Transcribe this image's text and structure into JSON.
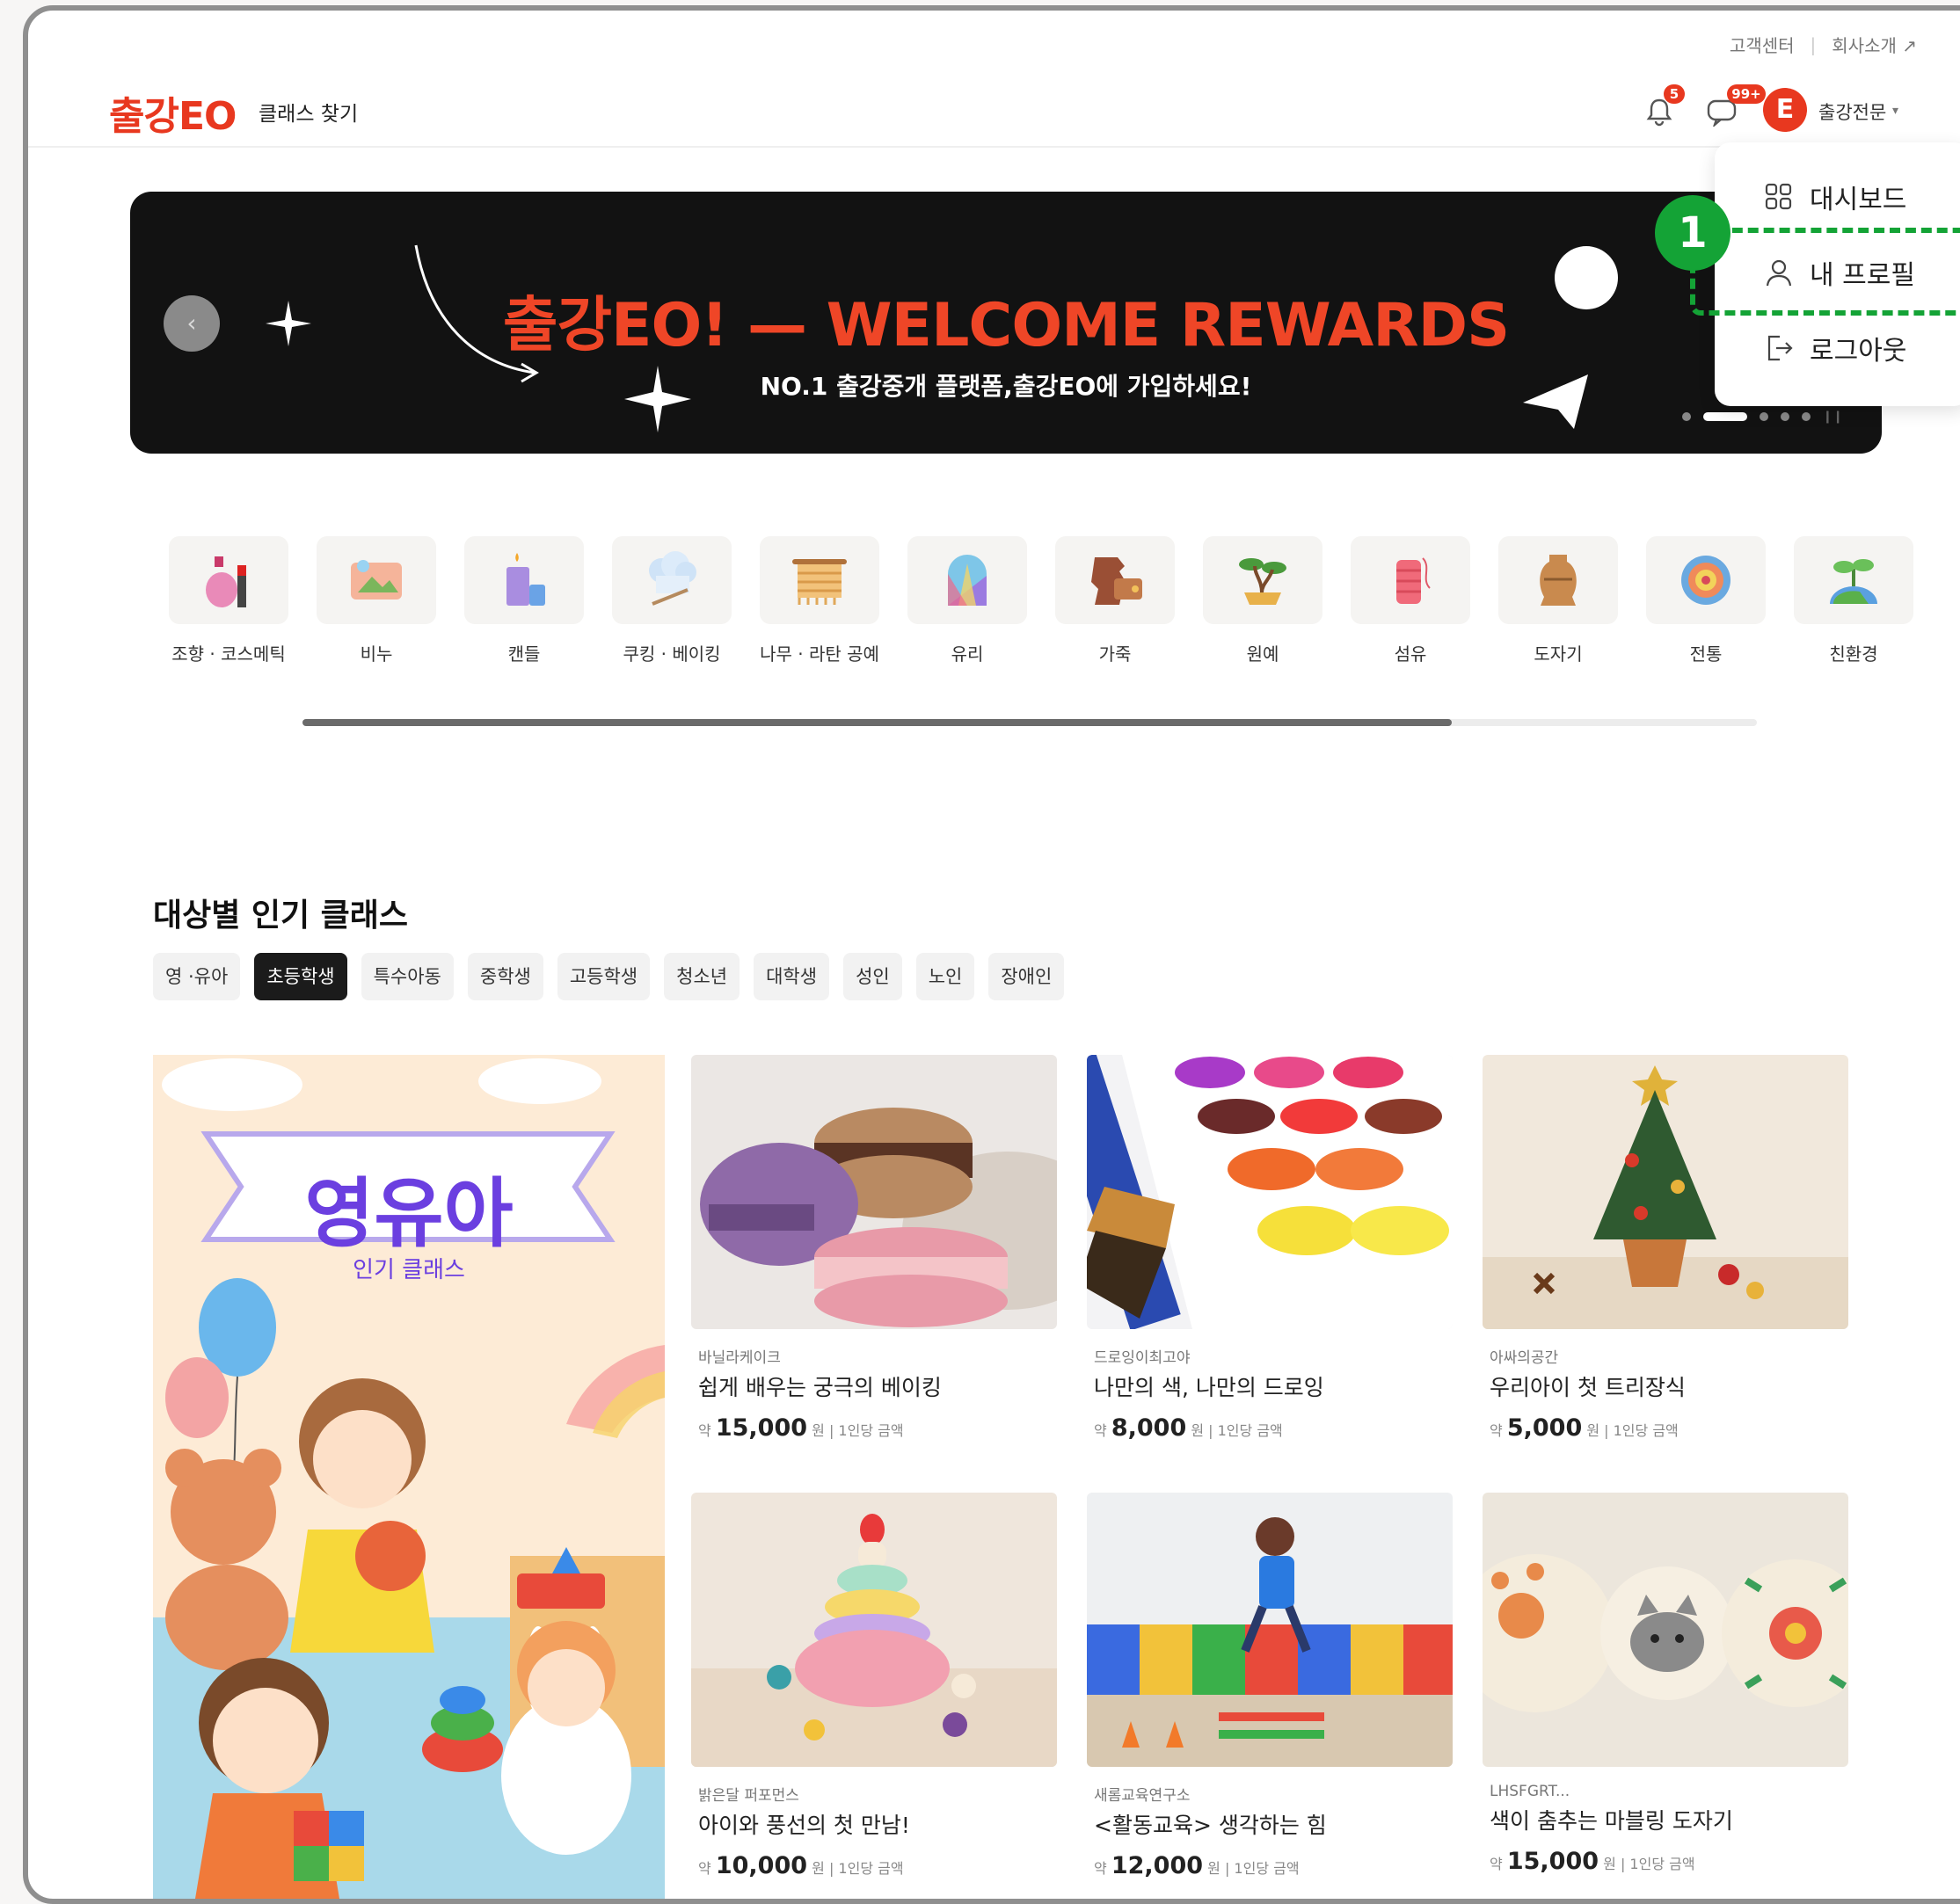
{
  "utility": {
    "support": "고객센터",
    "about": "회사소개 ↗"
  },
  "header": {
    "logo": "출강EO",
    "nav_find": "클래스 찾기",
    "notif_count": "5",
    "msg_count": "99+",
    "avatar_letter": "E",
    "username": "출강전문",
    "caret": "▾"
  },
  "banner": {
    "prev": "‹",
    "title": "출강EO! — WELCOME REWARDS",
    "subtitle": "NO.1 출강중개 플랫폼,출강EO에 가입하세요!"
  },
  "dropdown": {
    "items": [
      {
        "label": "대시보드",
        "icon": "dashboard-icon"
      },
      {
        "label": "내 프로필",
        "icon": "user-icon"
      },
      {
        "label": "로그아웃",
        "icon": "logout-icon"
      }
    ]
  },
  "annotation": {
    "number": "1"
  },
  "categories": [
    {
      "label": "조향 · 코스메틱"
    },
    {
      "label": "비누"
    },
    {
      "label": "캔들"
    },
    {
      "label": "쿠킹 · 베이킹"
    },
    {
      "label": "나무 · 라탄 공예"
    },
    {
      "label": "유리"
    },
    {
      "label": "가죽"
    },
    {
      "label": "원예"
    },
    {
      "label": "섬유"
    },
    {
      "label": "도자기"
    },
    {
      "label": "전통"
    },
    {
      "label": "친환경"
    }
  ],
  "category_scroll": {
    "position": 0.79
  },
  "section": {
    "title": "대상별 인기 클래스",
    "chips": [
      "영 ·유아",
      "초등학생",
      "특수아동",
      "중학생",
      "고등학생",
      "청소년",
      "대학생",
      "성인",
      "노인",
      "장애인"
    ],
    "active_chip": "초등학생"
  },
  "hero": {
    "title": "영유아",
    "subtitle": "인기 클래스"
  },
  "cards": [
    {
      "shop": "바닐라케이크",
      "title": "쉽게 배우는 궁극의 베이킹",
      "price_prefix": "약",
      "price": "15,000",
      "unit": "원",
      "note": "1인당 금액"
    },
    {
      "shop": "드로잉이최고야",
      "title": "나만의 색, 나만의 드로잉",
      "price_prefix": "약",
      "price": "8,000",
      "unit": "원",
      "note": "1인당 금액"
    },
    {
      "shop": "아싸의공간",
      "title": "우리아이 첫 트리장식",
      "price_prefix": "약",
      "price": "5,000",
      "unit": "원",
      "note": "1인당 금액"
    },
    {
      "shop": "밝은달 퍼포먼스",
      "title": "아이와 풍선의 첫 만남!",
      "price_prefix": "약",
      "price": "10,000",
      "unit": "원",
      "note": "1인당 금액"
    },
    {
      "shop": "새롬교육연구소",
      "title": "<활동교육> 생각하는 힘",
      "price_prefix": "약",
      "price": "12,000",
      "unit": "원",
      "note": "1인당 금액"
    },
    {
      "shop": "LHSFGRT...",
      "title": "색이 춤추는 마블링 도자기",
      "price_prefix": "약",
      "price": "15,000",
      "unit": "원",
      "note": "1인당 금액"
    }
  ],
  "colors": {
    "brand": "#e8381f",
    "annotation": "#14a336",
    "hero_text": "#6b3fe0"
  }
}
